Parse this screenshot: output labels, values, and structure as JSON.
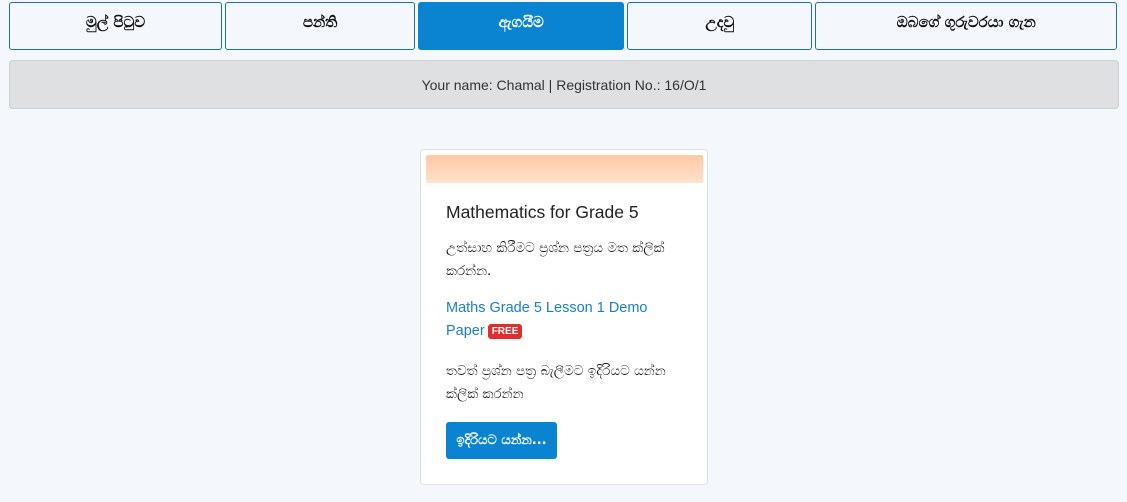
{
  "nav": {
    "tabs": [
      {
        "label": "මුල් පිටුව"
      },
      {
        "label": "පන්ති"
      },
      {
        "label": "ඇගයීම"
      },
      {
        "label": "උදවු"
      },
      {
        "label": "ඔබගේ ගුරුවරයා ගැන"
      }
    ],
    "active_index": 2
  },
  "info": {
    "text": "Your name: Chamal | Registration No.: 16/O/1"
  },
  "card": {
    "title": "Mathematics for Grade 5",
    "description": "උත්සාහ කිරීමට ප්‍රශ්න පත්‍රය මත ක්ලික් කරන්න.",
    "link_label": "Maths Grade 5 Lesson 1 Demo Paper",
    "badge": "FREE",
    "more_text": "තවත් ප්‍රශ්න පත්‍ර බැලීමට ඉදිරියට යන්න ක්ලික් කරන්න",
    "button_label": "ඉදිරියට යන්න..."
  },
  "colors": {
    "accent": "#0a84d0",
    "badge": "#e02d2d",
    "link": "#1a7fc4"
  }
}
